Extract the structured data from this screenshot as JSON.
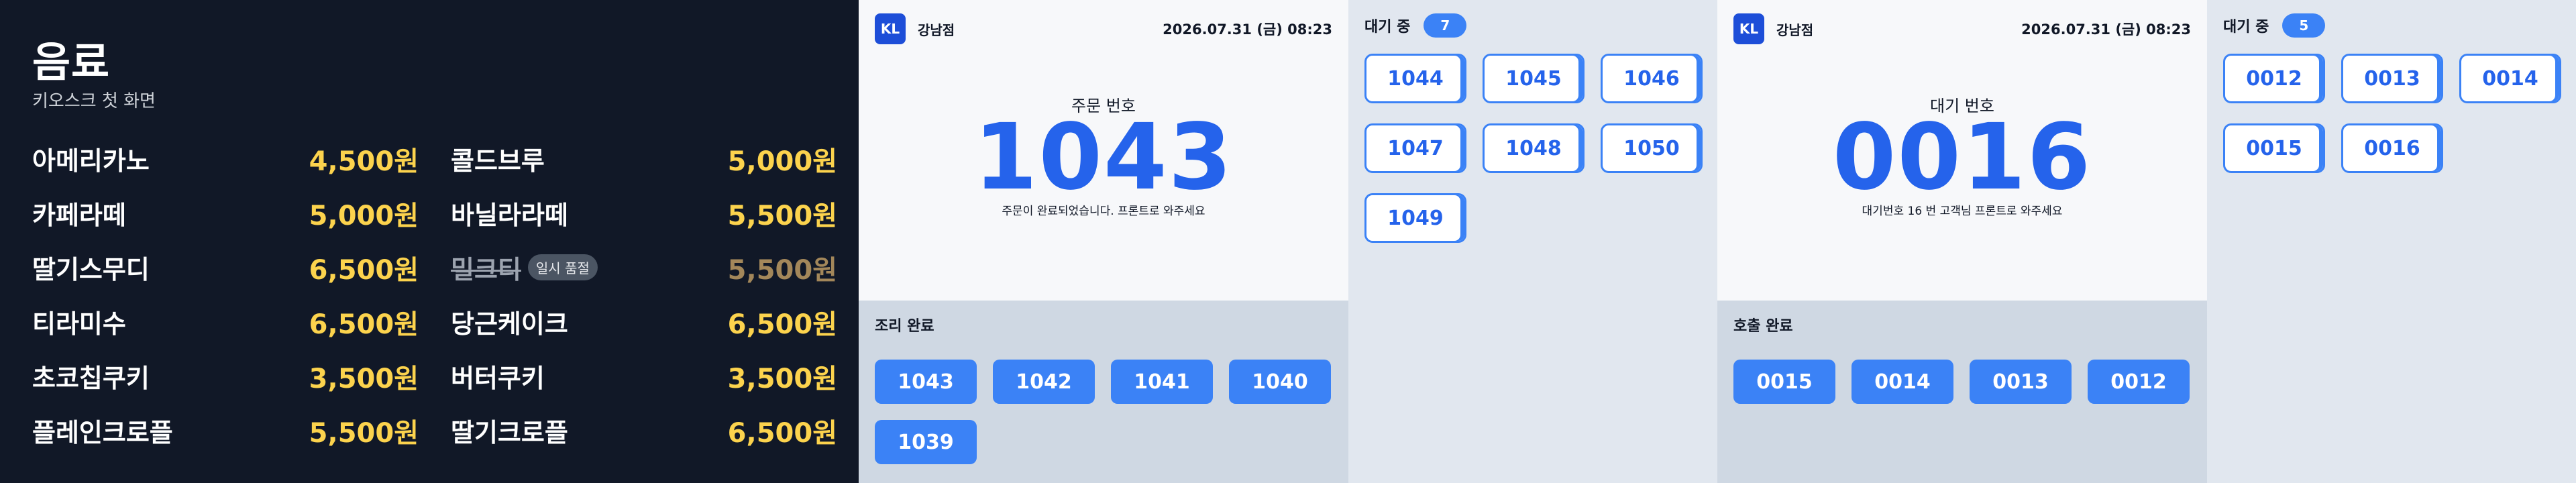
{
  "menu": {
    "title": "음료",
    "subtitle": "키오스크 첫 화면",
    "items": [
      {
        "name": "아메리카노",
        "price": "4,500원"
      },
      {
        "name": "콜드브루",
        "price": "5,000원"
      },
      {
        "name": "카페라떼",
        "price": "5,000원"
      },
      {
        "name": "바닐라라떼",
        "price": "5,500원"
      },
      {
        "name": "딸기스무디",
        "price": "6,500원"
      },
      {
        "name": "밀크티",
        "price": "5,500원",
        "badge": "일시 품절",
        "sold_out": true
      },
      {
        "name": "티라미수",
        "price": "6,500원"
      },
      {
        "name": "당근케이크",
        "price": "6,500원"
      },
      {
        "name": "초코칩쿠키",
        "price": "3,500원"
      },
      {
        "name": "버터쿠키",
        "price": "3,500원"
      },
      {
        "name": "플레인크로플",
        "price": "5,500원"
      },
      {
        "name": "딸기크로플",
        "price": "6,500원"
      }
    ]
  },
  "order_board": {
    "brand_logo": "KL",
    "store": "강남점",
    "datetime": "2026.07.31 (금) 08:23",
    "label": "주문 번호",
    "number": "1043",
    "message": "주문이 완료되었습니다. 프론트로 와주세요",
    "done_title": "조리 완료",
    "done": [
      "1043",
      "1042",
      "1041",
      "1040",
      "1039"
    ],
    "queue_title": "대기 중",
    "queue_count": "7",
    "queue": [
      "1044",
      "1045",
      "1046",
      "1047",
      "1048",
      "1050",
      "1049"
    ]
  },
  "wait_board": {
    "brand_logo": "KL",
    "store": "강남점",
    "datetime": "2026.07.31 (금) 08:23",
    "label": "대기 번호",
    "number": "0016",
    "message": "대기번호 16 번 고객님 프론트로 와주세요",
    "done_title": "호출 완료",
    "done": [
      "0015",
      "0014",
      "0013",
      "0012"
    ],
    "queue_title": "대기 중",
    "queue_count": "5",
    "queue": [
      "0012",
      "0013",
      "0014",
      "0015",
      "0016"
    ]
  },
  "colors": {
    "accent": "#3b82f6",
    "price": "#fcd34d",
    "menu_bg": "#111827"
  }
}
